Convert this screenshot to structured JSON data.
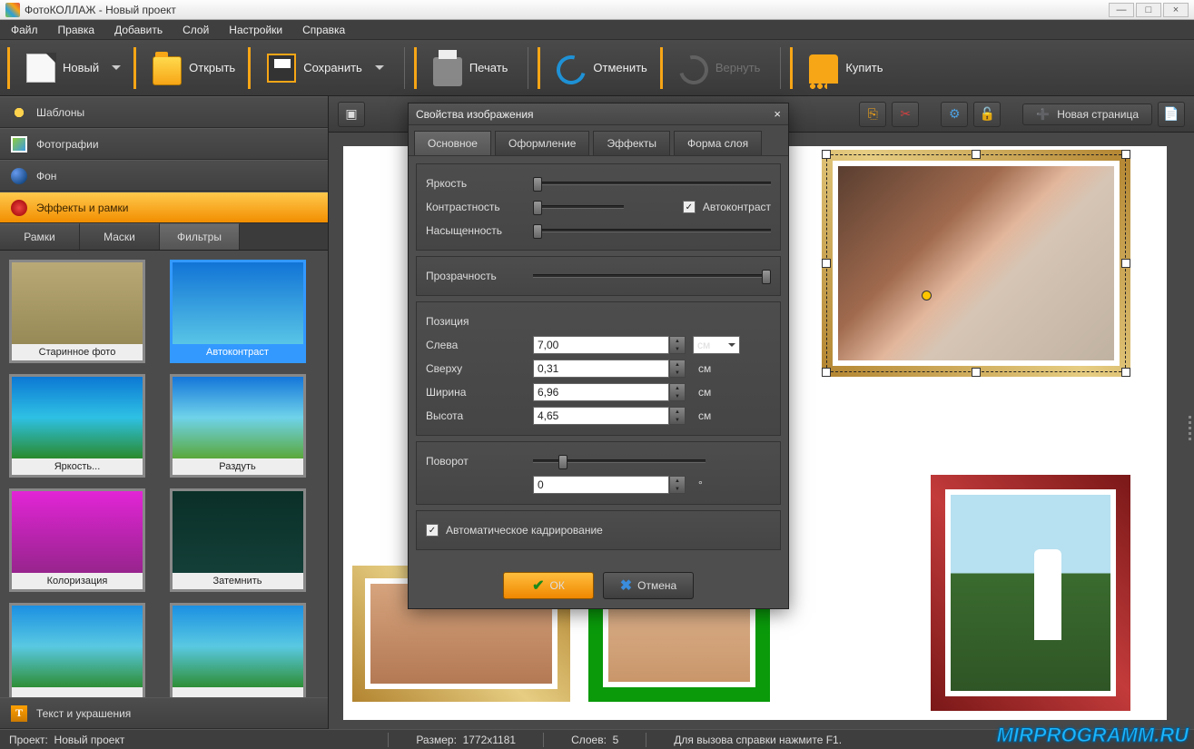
{
  "title": "ФотоКОЛЛАЖ - Новый проект",
  "menu": [
    "Файл",
    "Правка",
    "Добавить",
    "Слой",
    "Настройки",
    "Справка"
  ],
  "toolbar": {
    "new": "Новый",
    "open": "Открыть",
    "save": "Сохранить",
    "print": "Печать",
    "undo": "Отменить",
    "redo": "Вернуть",
    "buy": "Купить"
  },
  "sidebar": {
    "templates": "Шаблоны",
    "photos": "Фотографии",
    "background": "Фон",
    "effects": "Эффекты и рамки",
    "text": "Текст и украшения"
  },
  "subtabs": {
    "frames": "Рамки",
    "masks": "Маски",
    "filters": "Фильтры"
  },
  "filters": [
    "Старинное фото",
    "Автоконтраст",
    "Яркость...",
    "Раздуть",
    "Колоризация",
    "Затемнить",
    "",
    ""
  ],
  "wsToolbar": {
    "newPage": "Новая страница"
  },
  "dialog": {
    "title": "Свойства изображения",
    "tabs": {
      "main": "Основное",
      "design": "Оформление",
      "effects": "Эффекты",
      "shape": "Форма слоя"
    },
    "labels": {
      "brightness": "Яркость",
      "contrast": "Контрастность",
      "saturation": "Насыщенность",
      "autocontrast": "Автоконтраст",
      "opacity": "Прозрачность",
      "position": "Позиция",
      "left": "Слева",
      "top": "Сверху",
      "width": "Ширина",
      "height": "Высота",
      "rotation": "Поворот",
      "autocrop": "Автоматическое кадрирование"
    },
    "values": {
      "left": "7,00",
      "top": "0,31",
      "width": "6,96",
      "height": "4,65",
      "rotation": "0",
      "unit": "см",
      "degree": "°"
    },
    "buttons": {
      "ok": "ОК",
      "cancel": "Отмена"
    }
  },
  "status": {
    "projectLbl": "Проект:",
    "projectVal": "Новый проект",
    "sizeLbl": "Размер:",
    "sizeVal": "1772x1181",
    "layersLbl": "Слоев:",
    "layersVal": "5",
    "hint": "Для вызова справки нажмите F1."
  },
  "watermark": "MIRPROGRAMM.RU"
}
